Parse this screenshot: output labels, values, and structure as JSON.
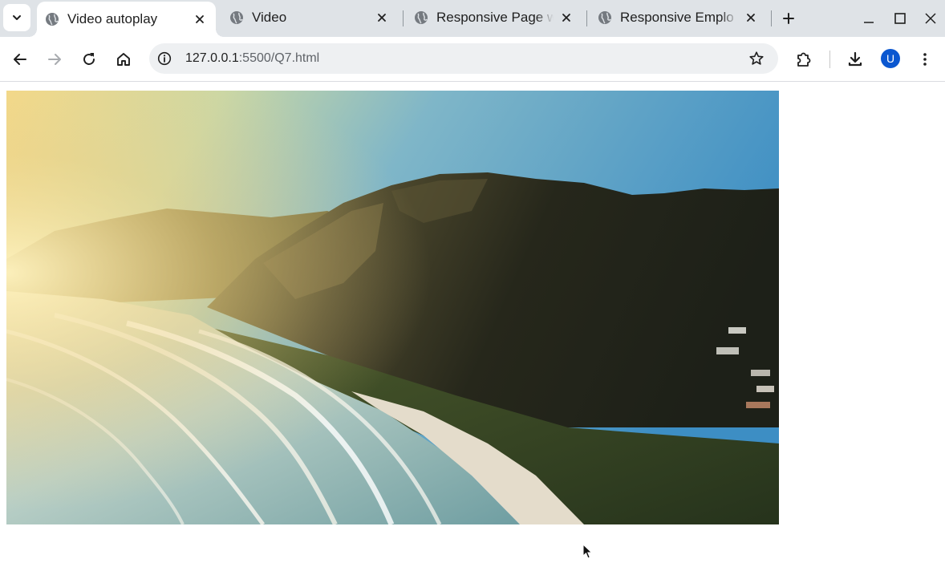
{
  "browser": {
    "tabs": [
      {
        "title": "Video autoplay",
        "active": true
      },
      {
        "title": "Video",
        "active": false
      },
      {
        "title": "Responsive Page w",
        "active": false
      },
      {
        "title": "Responsive Emplo",
        "active": false
      }
    ],
    "icons": {
      "tab_search": "chevron-down-icon",
      "favicon": "globe-icon",
      "tab_close": "close-icon",
      "new_tab": "plus-icon",
      "minimize": "minimize-icon",
      "maximize": "maximize-icon",
      "window_close": "close-icon",
      "back": "arrow-left-icon",
      "forward": "arrow-right-icon",
      "reload": "reload-icon",
      "home": "home-icon",
      "site_info": "info-icon",
      "bookmark": "star-icon",
      "extensions": "puzzle-icon",
      "downloads": "download-icon",
      "menu": "kebab-menu-icon"
    },
    "toolbar": {
      "url_host": "127.0.0.1",
      "url_rest": ":5500/Q7.html",
      "forward_enabled": false,
      "profile_initial": "U"
    }
  },
  "page": {
    "video": {
      "description_icon": "video-frame",
      "content": "coastal mountains at sunrise with ocean waves"
    }
  },
  "colors": {
    "tabstrip_bg": "#dfe3e7",
    "omnibox_bg": "#eef0f2",
    "avatar_bg": "#0b57d0",
    "icon": "#444746"
  }
}
